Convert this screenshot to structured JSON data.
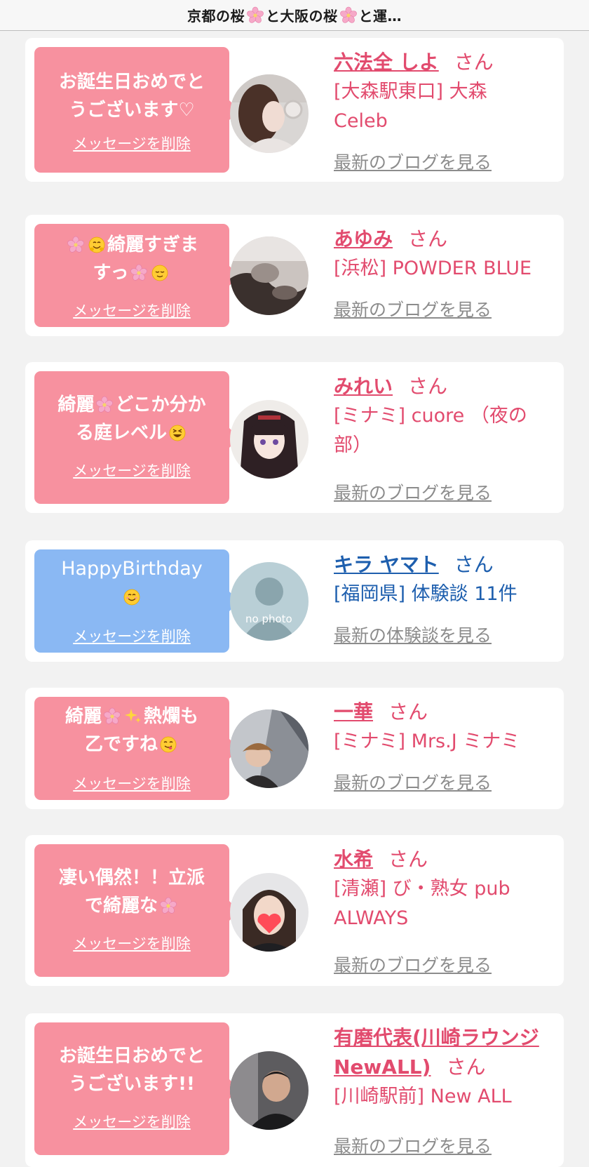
{
  "header": {
    "title_part1": "京都の桜",
    "title_part2": "と大阪の桜",
    "title_part3": "と運…"
  },
  "common": {
    "delete_label": "メッセージを削除",
    "san_label": "さん"
  },
  "colors": {
    "pink_bubble": "#f7919f",
    "blue_bubble": "#8ab8f3",
    "pink_text": "#e24b6e",
    "blue_text": "#1e5fae",
    "link_gray": "#8c8c8c"
  },
  "cards": [
    {
      "msg_line1": "お誕生日おめでと",
      "msg_line2": "うございます♡",
      "name": "六法全 しよ",
      "shop_line1": "[大森駅東口] 大森",
      "shop_line2": "Celeb",
      "blog_link": "最新のブログを見る",
      "avatar_icon": "woman-profile-photo"
    },
    {
      "msg_pre": "",
      "msg_mid": "綺麗すぎま",
      "msg_line2_a": "すっ",
      "msg_line2_b": "",
      "name": "あゆみ",
      "shop_line1": "[浜松] POWDER BLUE",
      "blog_link": "最新のブログを見る",
      "avatar_icon": "blurred-photo"
    },
    {
      "msg_line1_a": "綺麗",
      "msg_line1_b": "どこか分か",
      "msg_line2_a": "る庭レベル",
      "name": "みれい",
      "shop_line1": "[ミナミ] cuore （夜の",
      "shop_line2": "部）",
      "blog_link": "最新のブログを見る",
      "avatar_icon": "anime-character-photo"
    },
    {
      "msg_line1": "HappyBirthday",
      "name": "キラ ヤマト",
      "shop_line1": "[福岡県] 体験談 11件",
      "blog_link": "最新の体験談を見る",
      "avatar_icon": "no-photo-placeholder",
      "avatar_text": "no photo"
    },
    {
      "msg_line1_a": "綺麗",
      "msg_line1_b": "熱爛も",
      "msg_line2_a": "乙ですね",
      "name": "一華",
      "shop_line1": "[ミナミ] Mrs.J ミナミ",
      "blog_link": "最新のブログを見る",
      "avatar_icon": "woman-selfie-photo"
    },
    {
      "msg_line1": "凄い偶然！！立派",
      "msg_line2_a": "で綺麗な",
      "name": "水希",
      "shop_line1": "[清瀬] び・熟女 pub",
      "shop_line2": "ALWAYS",
      "blog_link": "最新のブログを見る",
      "avatar_icon": "woman-heart-face-photo"
    },
    {
      "msg_line1": "お誕生日おめでと",
      "msg_line2": "うございます!!",
      "name_line1": "有磨代表(川崎ラウンジ",
      "name_line2": "NewALL)",
      "shop_line1": "[川崎駅前] New ALL",
      "blog_link": "最新のブログを見る",
      "avatar_icon": "man-photo"
    }
  ]
}
